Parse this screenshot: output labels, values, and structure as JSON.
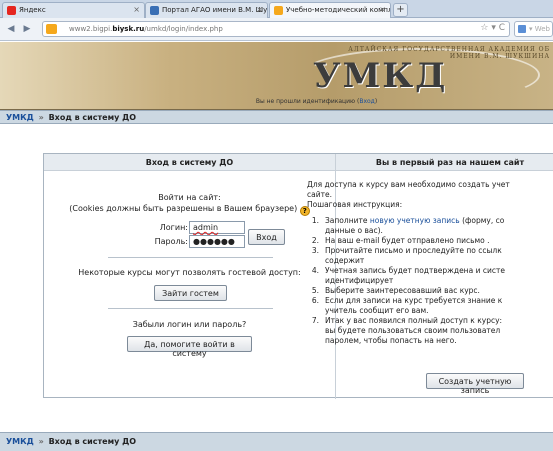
{
  "browser": {
    "tabs": [
      {
        "title": "Яндекс",
        "icon": "yandex-favicon",
        "color": "#e52620",
        "active": false
      },
      {
        "title": "Портал АГАО имени В.М. Шукшина",
        "icon": "portal-favicon",
        "color": "#3a6fb5",
        "active": false
      },
      {
        "title": "Учебно-методический комплекс дисци...",
        "icon": "umk-favicon",
        "color": "#f5a81c",
        "active": true
      }
    ],
    "new_tab": "+",
    "url_prefix": "www2.bigpi.",
    "url_host": "biysk.ru",
    "url_path": "/umkd/login/index.php",
    "url_controls": "☆ ▾ C",
    "search_placeholder": "▾ Web"
  },
  "banner": {
    "logo": "УМКД",
    "academy_line1": "АЛТАЙСКАЯ ГОСУДАРСТВЕННАЯ АКАДЕМИЯ ОБ",
    "academy_line2": "ИМЕНИ В.М. ШУКШИНА",
    "status_text": "Вы не прошли идентификацию (",
    "status_link": "Вход",
    "status_close": ")"
  },
  "breadcrumb": {
    "home": "УМКД",
    "sep": "»",
    "current": "Вход в систему ДО"
  },
  "login": {
    "heading": "Вход в систему ДО",
    "enter_site": "Войти на сайт:",
    "cookies_note": "(Cookies должны быть разрешены в Вашем браузере)",
    "help_icon": "?",
    "login_label": "Логин:",
    "login_value": "admin",
    "password_label": "Пароль:",
    "password_value": "●●●●●●",
    "login_button": "Вход",
    "guest_note": "Некоторые курсы могут позволять гостевой доступ:",
    "guest_button": "Зайти гостем",
    "forgot_note": "Забыли логин или пароль?",
    "forgot_button": "Да, помогите войти в систему"
  },
  "signup": {
    "heading": "Вы в первый раз на нашем сайт",
    "intro1": "Для доступа к курсу вам необходимо создать учет",
    "intro2": "сайте.",
    "intro3": "Пошаговая инструкция:",
    "steps": [
      {
        "num": "1.",
        "lines": [
          "Заполните ",
          "новую учетную запись",
          " (форму, со"
        ]
      },
      {
        "num": "",
        "lines": [
          "данные о вас)."
        ]
      },
      {
        "num": "2.",
        "lines": [
          "На ваш e-mail будет отправлено письмо ."
        ]
      },
      {
        "num": "3.",
        "lines": [
          "Прочитайте письмо и проследуйте по ссылк"
        ]
      },
      {
        "num": "",
        "lines": [
          "содержит"
        ]
      },
      {
        "num": "4.",
        "lines": [
          "Учетная запись будет подтверждена и систе"
        ]
      },
      {
        "num": "",
        "lines": [
          "идентифицирует"
        ]
      },
      {
        "num": "5.",
        "lines": [
          "Выберите заинтересовавший вас курс."
        ]
      },
      {
        "num": "6.",
        "lines": [
          "Если для записи на курс требуется знание к"
        ]
      },
      {
        "num": "",
        "lines": [
          "учитель сообщит его вам."
        ]
      },
      {
        "num": "7.",
        "lines": [
          "Итак у вас появился полный доступ к курсу:"
        ]
      },
      {
        "num": "",
        "lines": [
          "вы будете пользоваться своим пользовател"
        ]
      },
      {
        "num": "",
        "lines": [
          "паролем, чтобы попасть на него."
        ]
      }
    ],
    "create_button": "Создать учетную запись"
  },
  "footer": {
    "home": "УМКД",
    "sep": "»",
    "current": "Вход в систему ДО"
  }
}
